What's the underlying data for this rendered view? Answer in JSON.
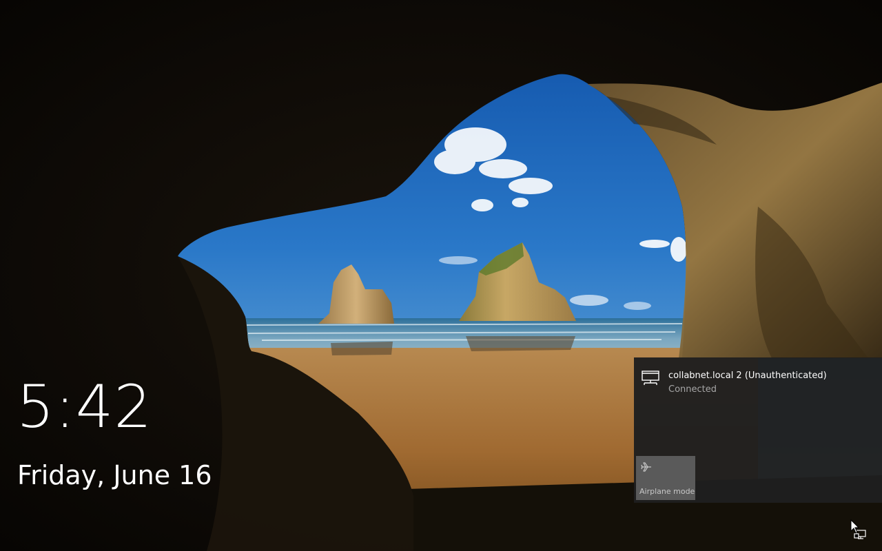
{
  "lock_screen": {
    "time": "5:42",
    "date": "Friday, June 16"
  },
  "network_flyout": {
    "network": {
      "name": "collabnet.local 2 (Unauthenticated)",
      "status": "Connected",
      "icon": "wired-network-icon"
    },
    "quick_actions": [
      {
        "label": "Airplane mode",
        "icon": "airplane-icon",
        "state": "off"
      }
    ]
  },
  "tray": {
    "icon": "network-tray-icon"
  },
  "colors": {
    "flyout_bg": "#1f1f1f",
    "tile_off": "#5a5a5a",
    "secondary_text": "#a6a6a6"
  }
}
